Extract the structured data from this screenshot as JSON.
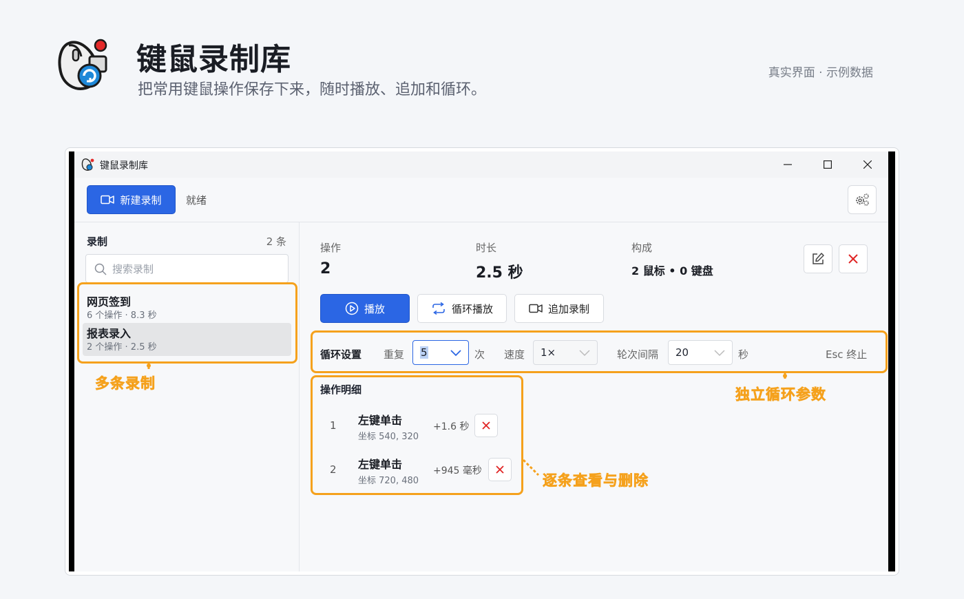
{
  "hero": {
    "title": "键鼠录制库",
    "subtitle": "把常用键鼠操作保存下来，随时播放、追加和循环。",
    "tag": "真实界面 · 示例数据"
  },
  "window": {
    "title": "键鼠录制库",
    "minimize_icon": "minimize-icon",
    "maximize_icon": "maximize-icon",
    "close_icon": "close-icon"
  },
  "toolbar": {
    "new_recording_label": "新建录制",
    "status": "就绪"
  },
  "sidebar": {
    "heading": "录制",
    "count": "2 条",
    "search_placeholder": "搜索录制",
    "items": [
      {
        "name": "网页签到",
        "meta": "6 个操作 · 8.3 秒",
        "selected": false
      },
      {
        "name": "报表录入",
        "meta": "2 个操作 · 2.5 秒",
        "selected": true
      }
    ]
  },
  "detail": {
    "stats": {
      "ops_label": "操作",
      "ops_value": "2",
      "duration_label": "时长",
      "duration_value": "2.5 秒",
      "composition_label": "构成",
      "composition_value": "2 鼠标 • 0 键盘"
    },
    "actions": {
      "play": "播放",
      "loop_play": "循环播放",
      "append_record": "追加录制"
    },
    "loop": {
      "title": "循环设置",
      "repeat_label": "重复",
      "repeat_value": "5",
      "repeat_unit": "次",
      "speed_label": "速度",
      "speed_value": "1×",
      "interval_label": "轮次间隔",
      "interval_value": "20",
      "interval_unit": "秒",
      "stop_hint": "Esc 终止"
    },
    "ops_title": "操作明细",
    "ops": [
      {
        "index": "1",
        "name": "左键单击",
        "coord": "坐标 540, 320",
        "delay": "+1.6 秒"
      },
      {
        "index": "2",
        "name": "左键单击",
        "coord": "坐标 720, 480",
        "delay": "+945 毫秒"
      }
    ]
  },
  "annotations": {
    "multi_record": "多条录制",
    "loop_params": "独立循环参数",
    "view_delete": "逐条查看与删除"
  },
  "colors": {
    "accent": "#2b66e4",
    "annotation": "#f5a11c",
    "danger": "#e02424"
  }
}
